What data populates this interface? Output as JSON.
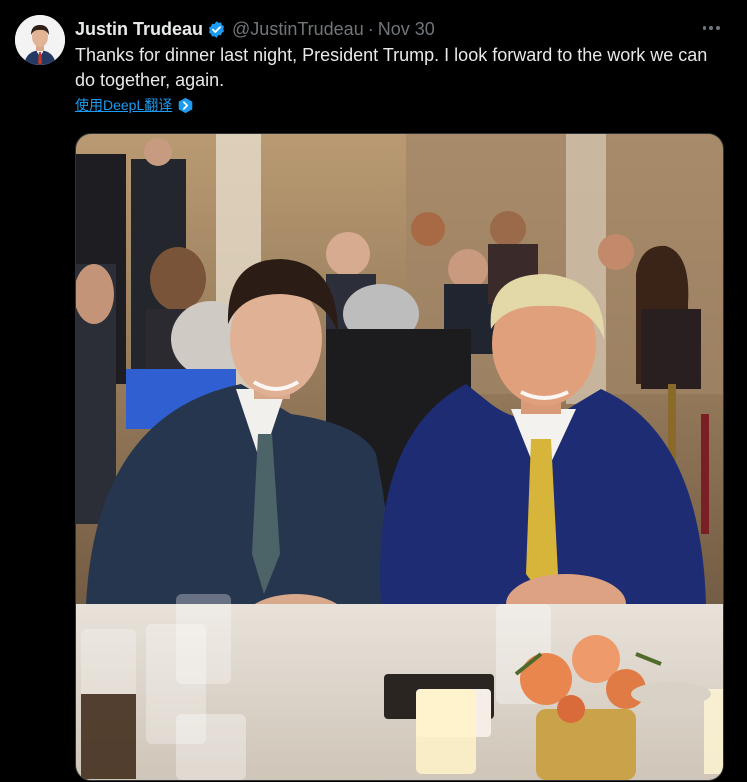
{
  "tweet": {
    "author_name": "Justin Trudeau",
    "handle": "@JustinTrudeau",
    "separator": "·",
    "date": "Nov 30",
    "text": "Thanks for dinner last night, President Trump. I look forward to the work we can do together, again.",
    "translate_label": "使用DeepL翻译"
  },
  "colors": {
    "background": "#000000",
    "text": "#e7e9ea",
    "muted": "#71767b",
    "link": "#1d9bf0",
    "verified": "#1d9bf0"
  },
  "icons": {
    "verified": "verified-badge-icon",
    "more": "more-options-icon",
    "translate": "deepl-icon"
  }
}
